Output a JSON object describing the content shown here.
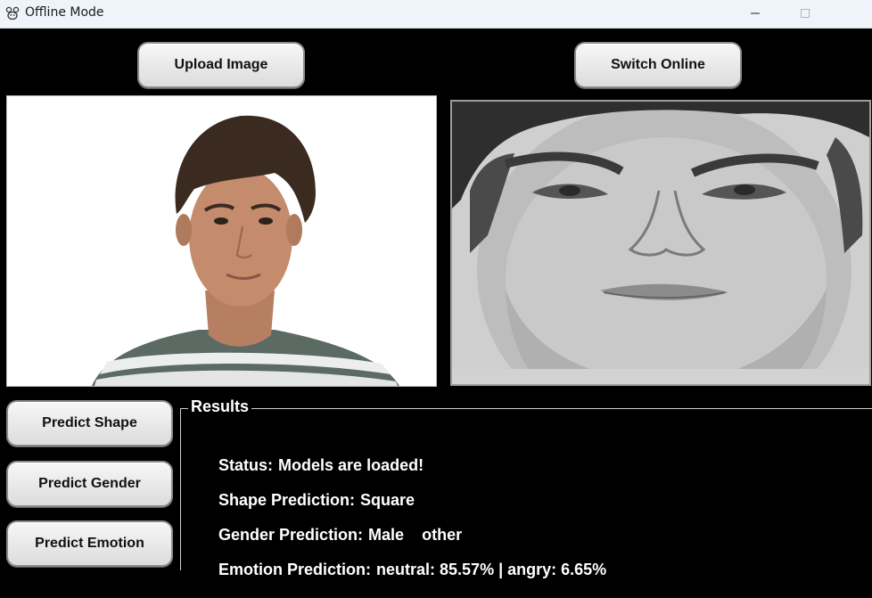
{
  "window": {
    "title": "Offline Mode",
    "icon": "app-icon"
  },
  "toolbar": {
    "upload_label": "Upload Image",
    "switch_label": "Switch Online"
  },
  "images": {
    "original": "portrait-photo",
    "processed": "grayscale-face-crop"
  },
  "predict_buttons": {
    "shape_label": "Predict Shape",
    "gender_label": "Predict Gender",
    "emotion_label": "Predict Emotion"
  },
  "results": {
    "title": "Results",
    "status_label": "Status:",
    "status_value": "Models are loaded!",
    "shape_label": "Shape Prediction:",
    "shape_value": "Square",
    "gender_label": "Gender Prediction:",
    "gender_value": "Male",
    "gender_extra": "other",
    "emotion_label": "Emotion Prediction:",
    "emotion_value": "neutral: 85.57% | angry: 6.65%"
  },
  "colors": {
    "background": "#000000",
    "titlebar": "#eef4f9",
    "button_face": "#e6e6e6",
    "text_light": "#ffffff"
  }
}
